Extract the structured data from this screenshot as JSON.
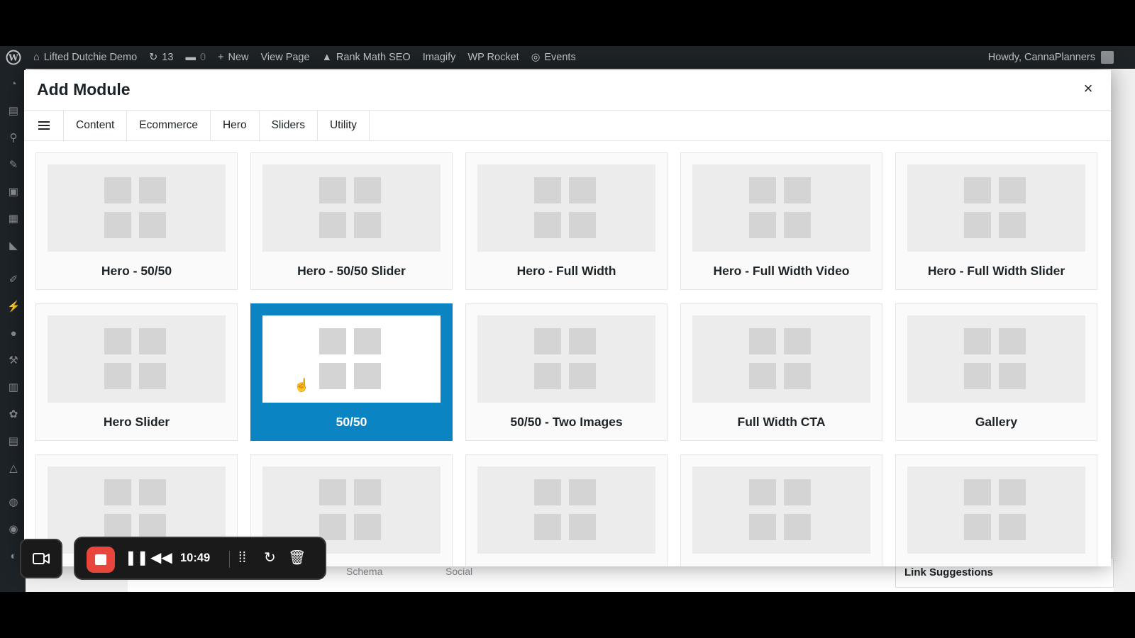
{
  "admin_bar": {
    "site_name": "Lifted Dutchie Demo",
    "updates": "13",
    "comments": "0",
    "new_label": "New",
    "view_page": "View Page",
    "rank_math": "Rank Math SEO",
    "imagify": "Imagify",
    "wp_rocket": "WP Rocket",
    "events": "Events",
    "howdy": "Howdy, CannaPlanners"
  },
  "modal": {
    "title": "Add Module",
    "close_label": "×",
    "tabs": [
      {
        "label": "Content"
      },
      {
        "label": "Ecommerce"
      },
      {
        "label": "Hero"
      },
      {
        "label": "Sliders"
      },
      {
        "label": "Utility"
      }
    ],
    "modules": [
      {
        "label": "Hero - 50/50",
        "selected": false
      },
      {
        "label": "Hero - 50/50 Slider",
        "selected": false
      },
      {
        "label": "Hero - Full Width",
        "selected": false
      },
      {
        "label": "Hero - Full Width Video",
        "selected": false
      },
      {
        "label": "Hero - Full Width Slider",
        "selected": false
      },
      {
        "label": "Hero Slider",
        "selected": false
      },
      {
        "label": "50/50",
        "selected": true
      },
      {
        "label": "50/50 - Two Images",
        "selected": false
      },
      {
        "label": "Full Width CTA",
        "selected": false
      },
      {
        "label": "Gallery",
        "selected": false
      },
      {
        "label": "",
        "selected": false
      },
      {
        "label": "",
        "selected": false
      },
      {
        "label": "",
        "selected": false
      },
      {
        "label": "",
        "selected": false
      },
      {
        "label": "",
        "selected": false
      }
    ]
  },
  "background_panel": {
    "tab_schema": "Schema",
    "tab_social": "Social",
    "link_suggestions": "Link Suggestions"
  },
  "recorder": {
    "time": "10:49"
  },
  "colors": {
    "selected_card": "#0a84c2",
    "record_stop": "#e8453c",
    "admin_bar": "#1d2327"
  }
}
